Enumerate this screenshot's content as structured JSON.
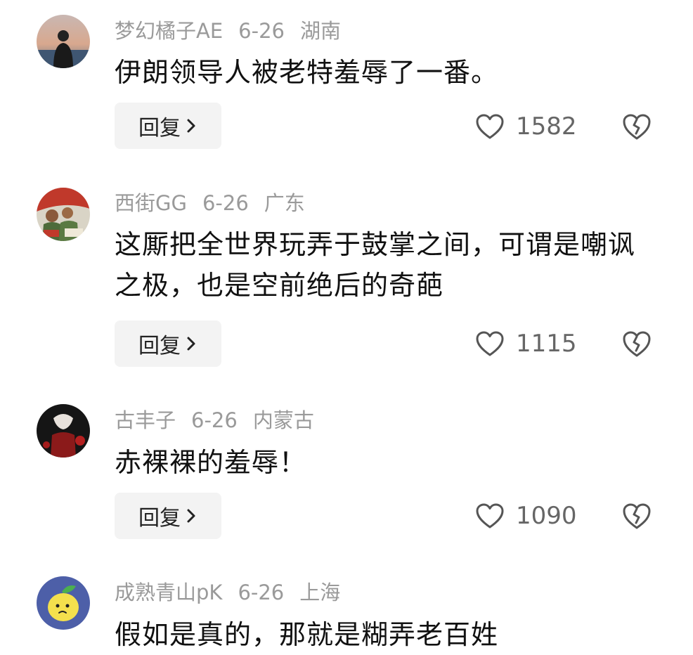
{
  "comments": [
    {
      "username": "梦幻橘子AE",
      "date": "6-26",
      "location": "湖南",
      "text": "伊朗领导人被老特羞辱了一番。",
      "reply_label": "回复",
      "likes": "1582",
      "avatar_icon": "person-silhouette-sunset-avatar"
    },
    {
      "username": "西街GG",
      "date": "6-26",
      "location": "广东",
      "text": "这厮把全世界玩弄于鼓掌之间，可谓是嘲讽之极，也是空前绝后的奇葩",
      "reply_label": "回复",
      "likes": "1115",
      "avatar_icon": "poster-art-avatar"
    },
    {
      "username": "古丰子",
      "date": "6-26",
      "location": "内蒙古",
      "text": "赤裸裸的羞辱！",
      "reply_label": "回复",
      "likes": "1090",
      "avatar_icon": "dark-red-figure-avatar"
    },
    {
      "username": "成熟青山pK",
      "date": "6-26",
      "location": "上海",
      "text": "假如是真的，那就是糊弄老百姓",
      "avatar_icon": "lemon-cartoon-avatar"
    }
  ],
  "icons": {
    "like": "heart-outline-icon",
    "dislike": "broken-heart-icon",
    "reply_arrow": "chevron-right-icon"
  },
  "colors": {
    "meta_text": "#9a9a9a",
    "body_text": "#111111",
    "reply_bg": "#f3f3f3",
    "icon_stroke": "#555555"
  }
}
